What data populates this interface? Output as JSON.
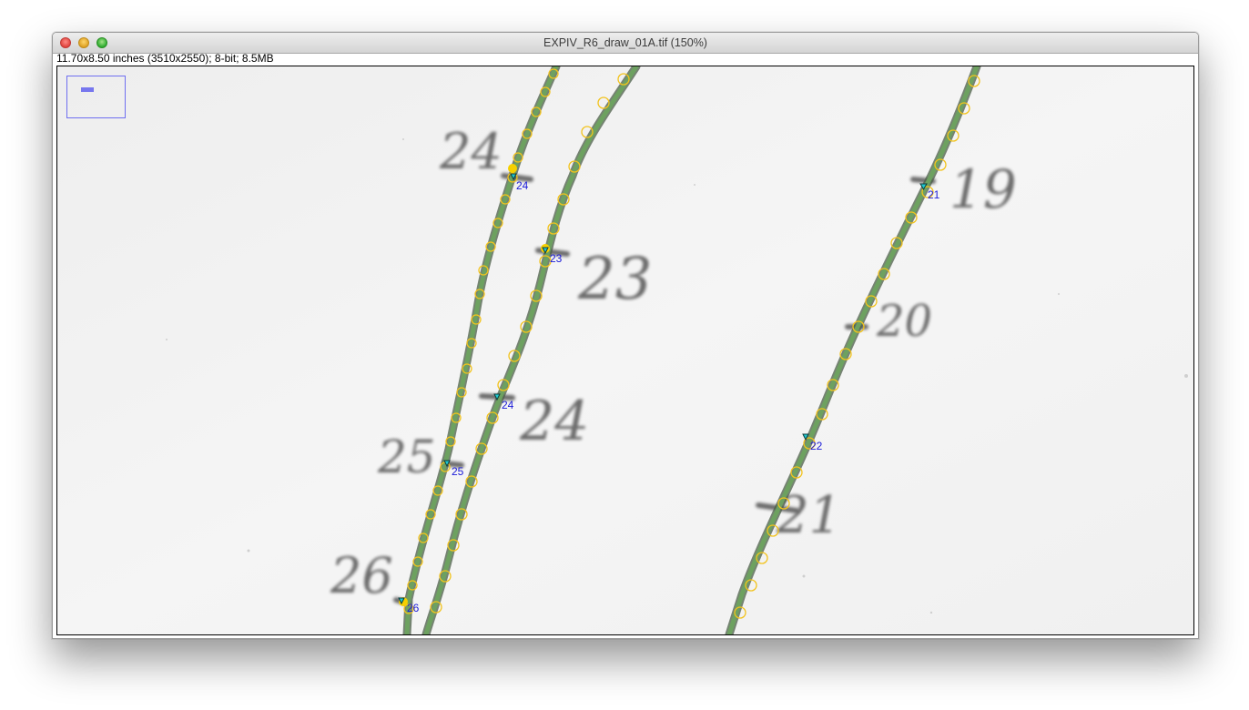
{
  "window": {
    "title": "EXPIV_R6_draw_01A.tif (150%)",
    "image_info": "11.70x8.50 inches (3510x2550); 8-bit; 8.5MB"
  },
  "colors": {
    "track_green": "#5f9a55",
    "marker_yellow": "#f2c31d",
    "label_blue": "#1a1ad8",
    "roi_purple": "#7777ee"
  },
  "handwriting": [
    "24",
    "23",
    "24",
    "25",
    "26",
    "19",
    "20",
    "21"
  ],
  "point_labels": [
    "24",
    "23",
    "24",
    "25",
    "26",
    "21",
    "22"
  ]
}
